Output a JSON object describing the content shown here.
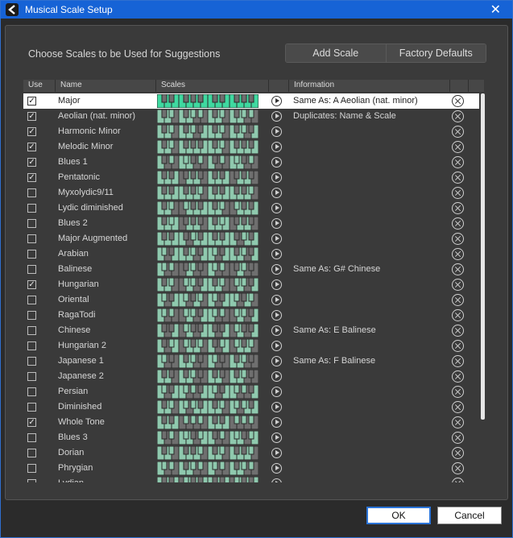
{
  "window": {
    "title": "Musical Scale Setup",
    "close_glyph": "✕",
    "app_icon": "cubase-logo-icon"
  },
  "header": {
    "heading": "Choose Scales to be Used for Suggestions",
    "add_scale": "Add Scale",
    "factory_defaults": "Factory Defaults"
  },
  "columns": {
    "use": "Use",
    "name": "Name",
    "scales": "Scales",
    "information": "Information"
  },
  "colors": {
    "accent": "#1663d6",
    "key_green": "#8fc9ae",
    "key_selected": "#3fd9a0",
    "key_dark": "#6f6f6f"
  },
  "rows": [
    {
      "use": true,
      "name": "Major",
      "info": "Same As:  A Aeolian (nat. minor)",
      "selected": true,
      "steps": [
        0,
        2,
        4,
        5,
        7,
        9,
        11
      ]
    },
    {
      "use": true,
      "name": "Aeolian (nat. minor)",
      "info": "Duplicates: Name & Scale",
      "selected": false,
      "steps": [
        0,
        2,
        3,
        5,
        7,
        8,
        10
      ]
    },
    {
      "use": true,
      "name": "Harmonic Minor",
      "info": "",
      "selected": false,
      "steps": [
        0,
        2,
        3,
        5,
        7,
        8,
        11
      ]
    },
    {
      "use": true,
      "name": "Melodic Minor",
      "info": "",
      "selected": false,
      "steps": [
        0,
        2,
        3,
        5,
        7,
        9,
        11
      ]
    },
    {
      "use": true,
      "name": "Blues 1",
      "info": "",
      "selected": false,
      "steps": [
        0,
        3,
        5,
        6,
        7,
        10
      ]
    },
    {
      "use": true,
      "name": "Pentatonic",
      "info": "",
      "selected": false,
      "steps": [
        0,
        2,
        4,
        7,
        9
      ]
    },
    {
      "use": false,
      "name": "Myxolydic9/11",
      "info": "",
      "selected": false,
      "steps": [
        0,
        2,
        4,
        5,
        7,
        9,
        10
      ]
    },
    {
      "use": false,
      "name": "Lydic diminished",
      "info": "",
      "selected": false,
      "steps": [
        0,
        2,
        3,
        6,
        7,
        9,
        11
      ]
    },
    {
      "use": false,
      "name": "Blues 2",
      "info": "",
      "selected": false,
      "steps": [
        0,
        2,
        3,
        4,
        7,
        9
      ]
    },
    {
      "use": false,
      "name": "Major Augmented",
      "info": "",
      "selected": false,
      "steps": [
        0,
        2,
        4,
        5,
        8,
        9,
        11
      ]
    },
    {
      "use": false,
      "name": "Arabian",
      "info": "",
      "selected": false,
      "steps": [
        0,
        1,
        4,
        5,
        7,
        8,
        11
      ]
    },
    {
      "use": false,
      "name": "Balinese",
      "info": "Same As:  G# Chinese",
      "selected": false,
      "steps": [
        0,
        1,
        3,
        7,
        8
      ]
    },
    {
      "use": true,
      "name": "Hungarian",
      "info": "",
      "selected": false,
      "steps": [
        0,
        2,
        3,
        6,
        7,
        8,
        11
      ]
    },
    {
      "use": false,
      "name": "Oriental",
      "info": "",
      "selected": false,
      "steps": [
        0,
        1,
        4,
        5,
        6,
        9,
        10
      ]
    },
    {
      "use": false,
      "name": "RagaTodi",
      "info": "",
      "selected": false,
      "steps": [
        0,
        1,
        3,
        6,
        7,
        8,
        11
      ]
    },
    {
      "use": false,
      "name": "Chinese",
      "info": "Same As:  E Balinese",
      "selected": false,
      "steps": [
        0,
        4,
        6,
        7,
        11
      ]
    },
    {
      "use": false,
      "name": "Hungarian 2",
      "info": "",
      "selected": false,
      "steps": [
        0,
        3,
        4,
        6,
        7,
        9,
        10
      ]
    },
    {
      "use": false,
      "name": "Japanese 1",
      "info": "Same As:  F Balinese",
      "selected": false,
      "steps": [
        0,
        1,
        5,
        7,
        8
      ]
    },
    {
      "use": false,
      "name": "Japanese 2",
      "info": "",
      "selected": false,
      "steps": [
        0,
        2,
        5,
        7,
        8
      ]
    },
    {
      "use": false,
      "name": "Persian",
      "info": "",
      "selected": false,
      "steps": [
        0,
        1,
        4,
        5,
        6,
        8,
        11
      ]
    },
    {
      "use": false,
      "name": "Diminished",
      "info": "",
      "selected": false,
      "steps": [
        0,
        2,
        3,
        5,
        6,
        8,
        9,
        11
      ]
    },
    {
      "use": true,
      "name": "Whole Tone",
      "info": "",
      "selected": false,
      "steps": [
        0,
        2,
        4,
        6,
        8,
        10
      ]
    },
    {
      "use": false,
      "name": "Blues 3",
      "info": "",
      "selected": false,
      "steps": [
        0,
        3,
        5,
        6,
        7,
        10,
        11
      ]
    },
    {
      "use": false,
      "name": "Dorian",
      "info": "",
      "selected": false,
      "steps": [
        0,
        2,
        3,
        5,
        7,
        9,
        10
      ]
    },
    {
      "use": false,
      "name": "Phrygian",
      "info": "",
      "selected": false,
      "steps": [
        0,
        1,
        3,
        5,
        7,
        8,
        10
      ]
    },
    {
      "use": false,
      "name": "Lydian",
      "info": "",
      "selected": false,
      "steps": [
        0,
        2,
        4,
        6,
        7,
        9,
        11
      ]
    }
  ],
  "footer": {
    "ok": "OK",
    "cancel": "Cancel"
  }
}
